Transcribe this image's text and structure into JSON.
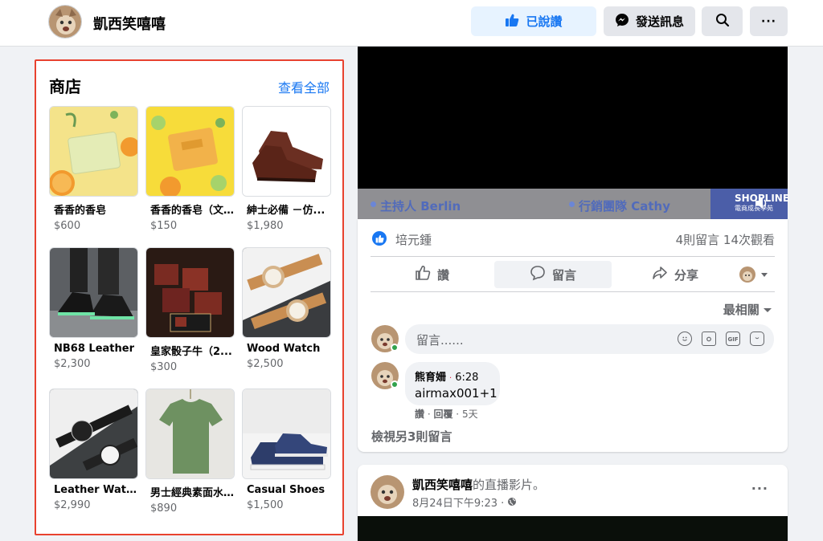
{
  "header": {
    "page_name": "凱西笑嘻嘻",
    "liked_label": "已說讚",
    "message_label": "發送訊息",
    "more_label": "···"
  },
  "shop": {
    "title": "商店",
    "see_all": "查看全部",
    "items": [
      {
        "name": "香香的香皂",
        "price": "$600"
      },
      {
        "name": "香香的香皂（文...",
        "price": "$150"
      },
      {
        "name": "紳士必備 －仿...",
        "price": "$1,980"
      },
      {
        "name": "NB68 Leather",
        "price": "$2,300"
      },
      {
        "name": "皇家骰子牛（2...",
        "price": "$300"
      },
      {
        "name": "Wood Watch",
        "price": "$2,500"
      },
      {
        "name": "Leather Watch",
        "price": "$2,990"
      },
      {
        "name": "男士經典素面水...",
        "price": "$890"
      },
      {
        "name": "Casual Shoes",
        "price": "$1,500"
      }
    ]
  },
  "video_banner": {
    "host": "主持人 Berlin",
    "team": "行銷團隊 Cathy",
    "logo": "SHOPLINE",
    "logo_sub": "電商成長學苑"
  },
  "post": {
    "reactor": "培元鍾",
    "counts": "4則留言  14次觀看",
    "like": "讚",
    "comment": "留言",
    "share": "分享",
    "sort": "最相關",
    "comment_placeholder": "留言......",
    "comment_author": "熊育姍",
    "comment_time": "6:28",
    "comment_text": "airmax001+1",
    "comment_like": "讚",
    "comment_reply": "回覆",
    "comment_age": "5天",
    "more_comments": "檢視另3則留言"
  },
  "post2": {
    "author": "凱西笑嘻嘻",
    "action": "的直播影片。",
    "date": "8月24日下午9:23 · "
  },
  "colors": {
    "accent": "#1877f2",
    "highlight_border": "#e8422f",
    "online": "#31a24c"
  }
}
